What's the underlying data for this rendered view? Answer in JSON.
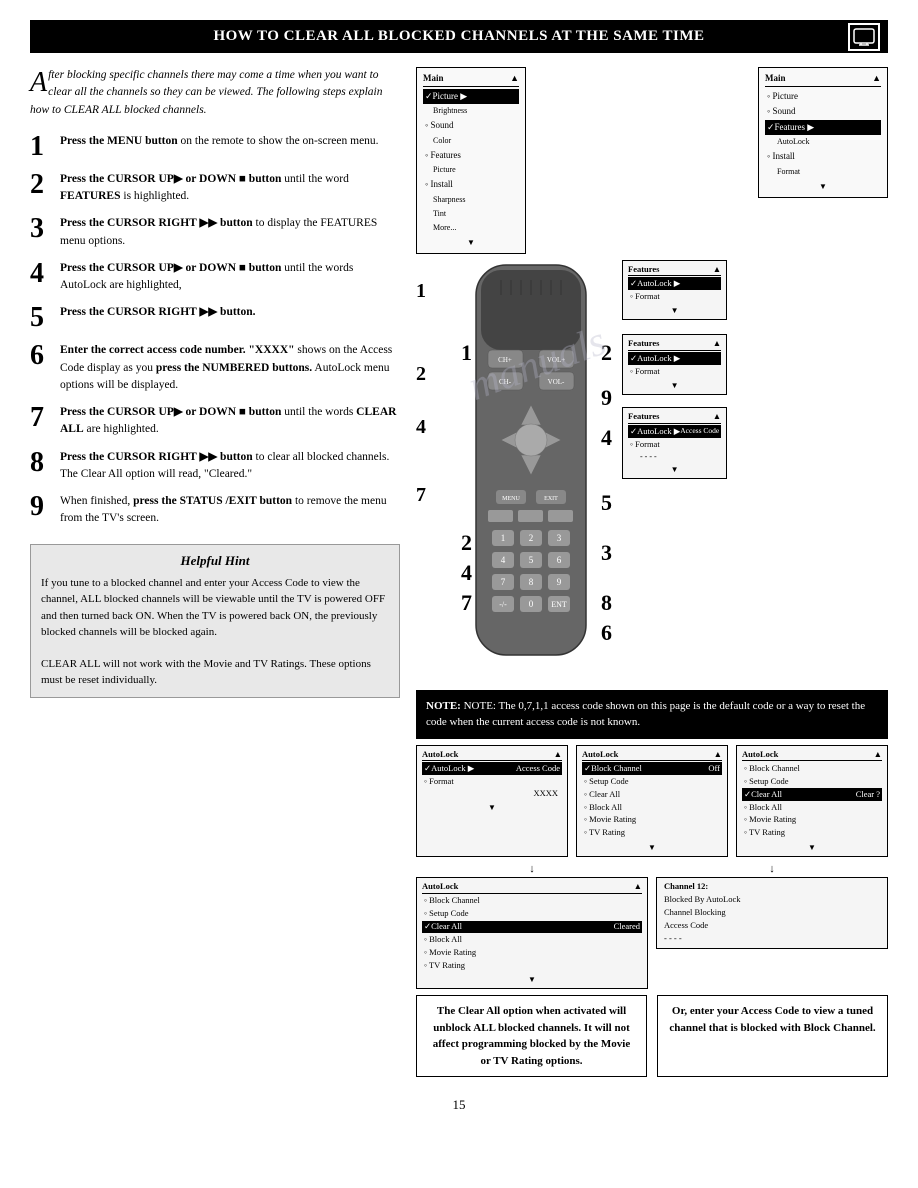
{
  "header": {
    "title": "How to Clear All Blocked Channels at the Same Time"
  },
  "intro": {
    "drop_cap": "A",
    "text": "fter blocking specific channels there may come a time when you want to clear all the channels so they can be viewed. The following steps explain how to CLEAR ALL blocked channels."
  },
  "steps": [
    {
      "number": "1",
      "text": "Press the MENU button on the remote to show the on-screen menu."
    },
    {
      "number": "2",
      "text": "Press the CURSOR UP▶ or DOWN ■ button until the word FEATURES is highlighted."
    },
    {
      "number": "3",
      "text": "Press the CURSOR RIGHT ▶▶ button to display the FEATURES menu options."
    },
    {
      "number": "4",
      "text": "Press the CURSOR UP▶ or DOWN ■ button until the words AutoLock are highlighted,"
    },
    {
      "number": "5",
      "text": "Press the CURSOR RIGHT ▶▶ button."
    },
    {
      "number": "6",
      "text": "Enter the correct access code number. \"XXXX\" shows on the Access Code display as you press the NUMBERED buttons. AutoLock menu options will be displayed."
    },
    {
      "number": "7",
      "text": "Press the CURSOR UP▶ or DOWN ■ button until the words CLEAR ALL are highlighted."
    },
    {
      "number": "8",
      "text": "Press the CURSOR RIGHT ▶▶ button to clear all blocked channels. The Clear All option will read, \"Cleared.\""
    },
    {
      "number": "9",
      "text": "When finished, press the STATUS /EXIT button to remove the menu from the TV's screen."
    }
  ],
  "hint": {
    "title": "Helpful Hint",
    "paragraphs": [
      "If you tune to a blocked channel and enter your Access Code to view the channel, ALL blocked channels will be viewable until the TV is powered OFF and then turned back ON. When the TV is powered back ON, the previously blocked channels will be blocked again.",
      "CLEAR ALL will not work with the Movie and TV Ratings. These options must be reset individually."
    ]
  },
  "note": {
    "text": "NOTE: The 0,7,1,1 access code shown on this page is the default code or a way to reset the code when the current access code is not known."
  },
  "caption_bottom_left": {
    "text": "The Clear All option when activated will unblock ALL blocked channels. It will not affect programming blocked by the Movie or TV Rating options."
  },
  "caption_bottom_right": {
    "text": "Or, enter your Access Code to view a tuned channel that is blocked with Block Channel."
  },
  "menu_screens": {
    "screen1": {
      "title": "Main",
      "items": [
        "✓Picture",
        "◦ Sound",
        "◦ Features",
        "◦ Install"
      ],
      "sub_items": [
        "Brightness",
        "Color",
        "Picture",
        "Sharpness",
        "Tint",
        "More..."
      ]
    },
    "screen2": {
      "title": "Main",
      "items": [
        "◦ Picture",
        "◦ Sound",
        "✓Features",
        "◦ Install"
      ],
      "sub_items": [
        "AutoLock",
        "Format"
      ]
    },
    "screen3": {
      "title": "Features",
      "items": [
        "✓AutoLock",
        "◦ Format"
      ]
    },
    "screen4": {
      "title": "Features",
      "items": [
        "✓AutoLock ▶",
        "◦ Format"
      ],
      "sub_label": "Access Code"
    },
    "screen5": {
      "title": "AutoLock",
      "items": [
        "✓Block Channel  Off",
        "◦ Setup Code",
        "◦ Clear All",
        "◦ Block All",
        "◦ Movie Rating",
        "◦ TV Rating"
      ]
    },
    "screen6": {
      "title": "AutoLock",
      "items": [
        "◦ Block Channel",
        "◦ Setup Code",
        "✓Clear All",
        "◦ Block All",
        "◦ Movie Rating",
        "◦ TV Rating"
      ],
      "clear_label": "Clear ?"
    },
    "screen7": {
      "title": "AutoLock",
      "items": [
        "◦ Block Channel",
        "◦ Setup Code",
        "✓Clear All  Cleared",
        "◦ Block All",
        "◦ Movie Rating",
        "◦ TV Rating"
      ]
    },
    "screen8": {
      "title": "Features",
      "items": [
        "✓AutoLock ▶",
        "◦ Format"
      ],
      "access_code": "XXXX"
    },
    "screen9": {
      "lines": [
        "Channel 12:",
        "Blocked By AutoLock",
        "Channel Blocking",
        "Access Code",
        "- - - -"
      ]
    }
  },
  "page_number": "15",
  "callout_numbers": [
    "1",
    "2",
    "3",
    "4",
    "5",
    "6",
    "7",
    "8",
    "9"
  ]
}
